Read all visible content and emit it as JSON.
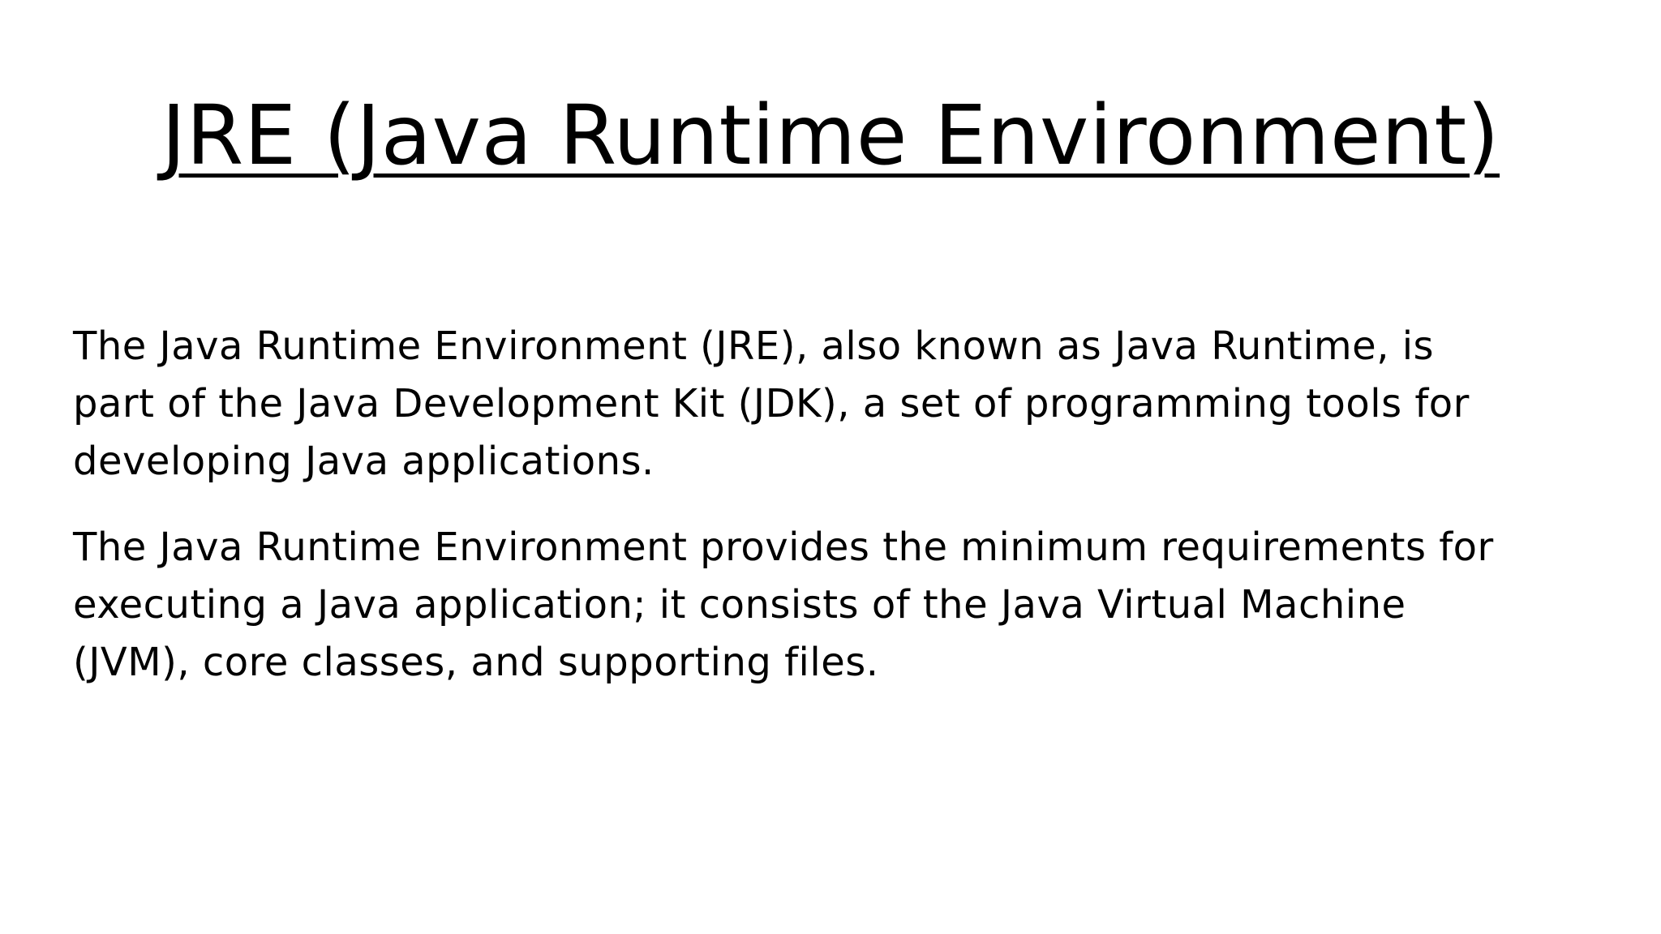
{
  "slide": {
    "title": "JRE (Java Runtime Environment)",
    "paragraphs": [
      {
        "lines": [
          "The Java Runtime Environment (JRE), also known as Java Runtime, is",
          "part of the Java Development Kit (JDK), a set of programming tools for",
          "developing Java applications."
        ]
      },
      {
        "lines": [
          "The Java Runtime Environment provides the minimum requirements for",
          "executing a Java application; it consists of the Java Virtual Machine",
          "(JVM), core classes, and supporting files."
        ]
      }
    ]
  }
}
